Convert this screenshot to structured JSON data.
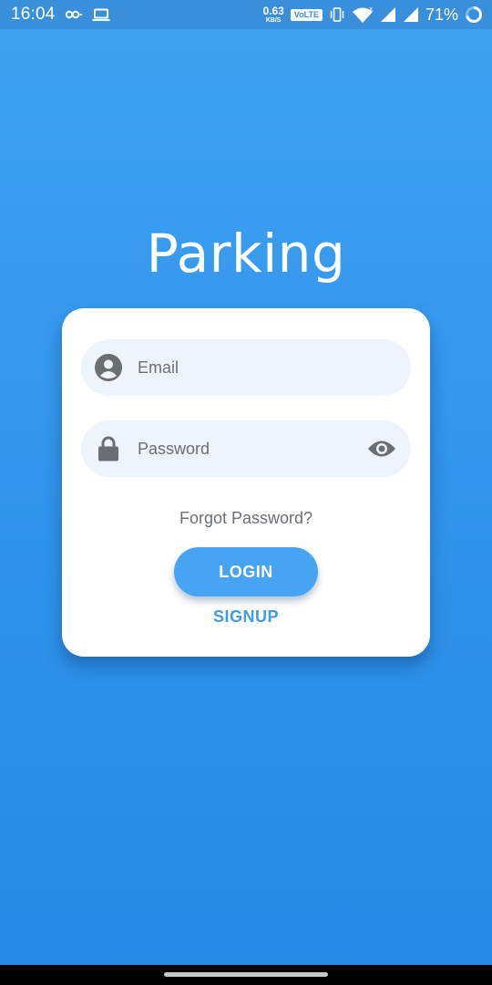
{
  "status_bar": {
    "time": "16:04",
    "left_icons": [
      "link-icon",
      "laptop-icon"
    ],
    "net_speed_value": "0.63",
    "net_speed_unit": "KB/S",
    "volte_label": "VoLTE",
    "right_icons": [
      "vibrate-icon",
      "wifi-icon",
      "signal-icon",
      "signal-icon",
      "battery-ring-icon"
    ],
    "battery_percent": "71%",
    "battery_level": 0.71
  },
  "app": {
    "title": "Parking"
  },
  "login_form": {
    "email_placeholder": "Email",
    "email_value": "",
    "password_placeholder": "Password",
    "password_value": "",
    "forgot_password_label": "Forgot Password?",
    "login_label": "LOGIN",
    "signup_label": "SIGNUP"
  },
  "colors": {
    "background_top": "#3fa3f1",
    "background_bottom": "#2589e5",
    "accent": "#46a4f2",
    "field_background": "#edf4fb",
    "icon_gray": "#6b6f73"
  }
}
